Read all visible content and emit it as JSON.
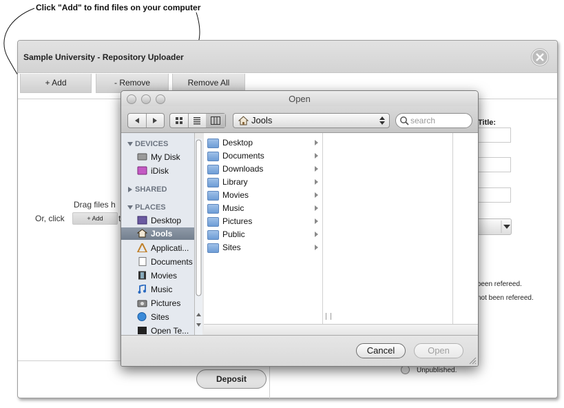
{
  "annotation": {
    "text": "Click \"Add\" to find files on your computer"
  },
  "app": {
    "title": "Sample University - Repository Uploader",
    "toolbar": {
      "add": "+ Add",
      "remove": "- Remove",
      "remove_all": "Remove All"
    },
    "drop_zone": {
      "line1": "Drag files h",
      "line2_prefix": "Or, click",
      "add_small": "+ Add",
      "line2_suffix": "t"
    },
    "deposit": "Deposit",
    "form": {
      "title_label": "Title:",
      "refereed_partial": "s been refereed.",
      "not_refereed_partial": "not been refereed.",
      "unpublished": "Unpublished."
    }
  },
  "dialog": {
    "title": "Open",
    "path": "Jools",
    "search_placeholder": "search",
    "sidebar": {
      "devices_header": "DEVICES",
      "devices": [
        "My Disk",
        "iDisk"
      ],
      "shared_header": "SHARED",
      "places_header": "PLACES",
      "places": [
        "Desktop",
        "Jools",
        "Applicati...",
        "Documents",
        "Movies",
        "Music",
        "Pictures",
        "Sites",
        "Open Te..."
      ],
      "selected": "Jools"
    },
    "folders": [
      "Desktop",
      "Documents",
      "Downloads",
      "Library",
      "Movies",
      "Music",
      "Pictures",
      "Public",
      "Sites"
    ],
    "cancel": "Cancel",
    "open": "Open"
  },
  "colors": {
    "sidebar_bg": "#e5e9ef",
    "selected_row": "#7a8696",
    "folder_blue": "#7ea8dc"
  }
}
